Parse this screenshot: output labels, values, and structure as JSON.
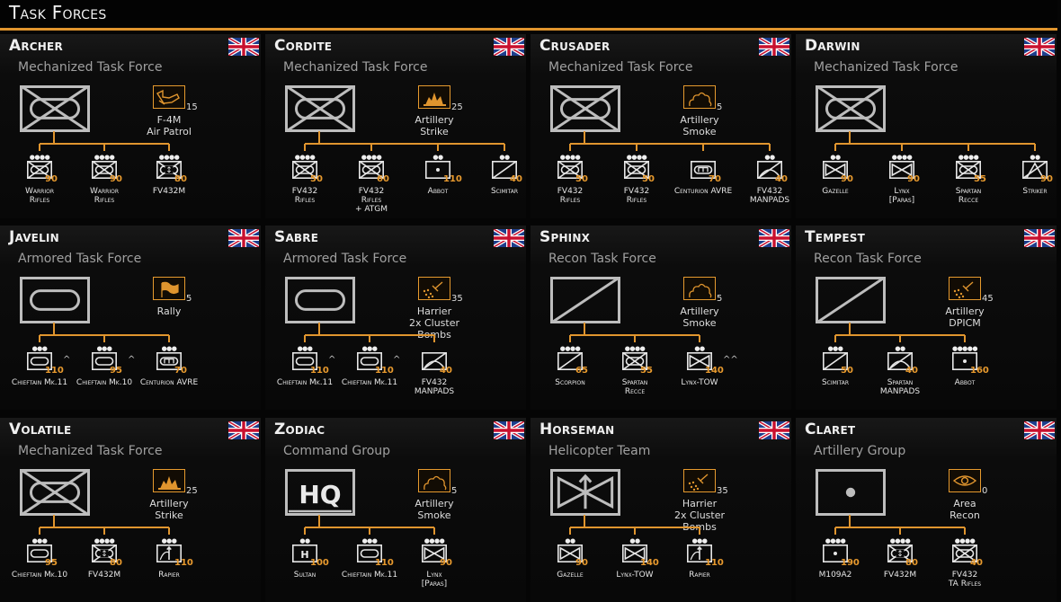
{
  "header": {
    "title": "Task Forces"
  },
  "colors": {
    "accent": "#e0952e",
    "value": "#e89a2e"
  },
  "cards": [
    {
      "name": "Archer",
      "type": "Mechanized Task Force",
      "symbol": "mech",
      "ability": {
        "icon": "jet-icon",
        "count": "15",
        "lines": [
          "F-4M",
          "Air Patrol"
        ]
      },
      "units": [
        {
          "dots": "●●●●",
          "sym": "mech",
          "val": "90",
          "lines": [
            "Warrior",
            "Rifles"
          ]
        },
        {
          "dots": "●●●●",
          "sym": "mech",
          "val": "90",
          "lines": [
            "Warrior",
            "Rifles"
          ]
        },
        {
          "dots": "●●●●",
          "sym": "apc",
          "val": "80",
          "lines": [
            "FV432M"
          ]
        }
      ]
    },
    {
      "name": "Cordite",
      "type": "Mechanized Task Force",
      "symbol": "mech",
      "ability": {
        "icon": "explosion-icon",
        "count": "25",
        "lines": [
          "Artillery",
          "Strike"
        ]
      },
      "units": [
        {
          "dots": "●●●●",
          "sym": "mech",
          "val": "50",
          "lines": [
            "FV432",
            "Rifles"
          ]
        },
        {
          "dots": "●●●●",
          "sym": "mech",
          "val": "60",
          "lines": [
            "FV432",
            "Rifles",
            "+ ATGM"
          ]
        },
        {
          "dots": "●●",
          "sym": "artillery",
          "val": "110",
          "lines": [
            "Abbot"
          ]
        },
        {
          "dots": "●●",
          "sym": "recon",
          "val": "40",
          "lines": [
            "Scimitar"
          ]
        }
      ]
    },
    {
      "name": "Crusader",
      "type": "Mechanized Task Force",
      "symbol": "mech",
      "ability": {
        "icon": "smoke-icon",
        "count": "5",
        "lines": [
          "Artillery",
          "Smoke"
        ]
      },
      "units": [
        {
          "dots": "●●●●",
          "sym": "mech",
          "val": "50",
          "lines": [
            "FV432",
            "Rifles"
          ]
        },
        {
          "dots": "●●●●",
          "sym": "mech",
          "val": "50",
          "lines": [
            "FV432",
            "Rifles"
          ]
        },
        {
          "dots": "",
          "sym": "engineer",
          "val": "70",
          "lines": [
            "Centurion AVRE"
          ]
        },
        {
          "dots": "●●",
          "sym": "airdefense",
          "val": "40",
          "lines": [
            "FV432",
            "MANPADS"
          ]
        }
      ]
    },
    {
      "name": "Darwin",
      "type": "Mechanized Task Force",
      "symbol": "mech",
      "ability": null,
      "units": [
        {
          "dots": "●●",
          "sym": "bowtie",
          "val": "90",
          "lines": [
            "Gazelle"
          ]
        },
        {
          "dots": "●●●●",
          "sym": "bowtie",
          "val": "90",
          "lines": [
            "Lynx",
            "[Paras]"
          ]
        },
        {
          "dots": "●●●●",
          "sym": "mech",
          "val": "55",
          "lines": [
            "Spartan",
            "Recce"
          ]
        },
        {
          "dots": "●●",
          "sym": "striker",
          "val": "90",
          "lines": [
            "Striker"
          ]
        }
      ]
    },
    {
      "name": "Javelin",
      "type": "Armored Task Force",
      "symbol": "armor",
      "ability": {
        "icon": "flag-icon",
        "count": "5",
        "lines": [
          "Rally"
        ]
      },
      "units": [
        {
          "dots": "●●●",
          "sym": "armor",
          "val": "110",
          "lines": [
            "Chieftain Mk.11"
          ],
          "marker": "^"
        },
        {
          "dots": "●●●",
          "sym": "armor",
          "val": "95",
          "lines": [
            "Chieftain Mk.10"
          ],
          "marker": "^"
        },
        {
          "dots": "●●●",
          "sym": "engineer",
          "val": "70",
          "lines": [
            "Centurion AVRE"
          ]
        }
      ]
    },
    {
      "name": "Sabre",
      "type": "Armored Task Force",
      "symbol": "armor",
      "ability": {
        "icon": "cluster-icon",
        "count": "35",
        "lines": [
          "Harrier",
          "2x Cluster",
          "Bombs"
        ]
      },
      "units": [
        {
          "dots": "●●●",
          "sym": "armor",
          "val": "110",
          "lines": [
            "Chieftain Mk.11"
          ],
          "marker": "^"
        },
        {
          "dots": "●●●",
          "sym": "armor",
          "val": "110",
          "lines": [
            "Chieftain Mk.11"
          ],
          "marker": "^"
        },
        {
          "dots": "",
          "sym": "airdefense",
          "val": "40",
          "lines": [
            "FV432",
            "MANPADS"
          ]
        }
      ]
    },
    {
      "name": "Sphinx",
      "type": "Recon Task Force",
      "symbol": "recon",
      "ability": {
        "icon": "smoke-icon",
        "count": "5",
        "lines": [
          "Artillery",
          "Smoke"
        ]
      },
      "units": [
        {
          "dots": "●●●●",
          "sym": "recon",
          "val": "65",
          "lines": [
            "Scorpion"
          ]
        },
        {
          "dots": "●●●●",
          "sym": "mech",
          "val": "55",
          "lines": [
            "Spartan",
            "Recce"
          ]
        },
        {
          "dots": "●●",
          "sym": "bowtie",
          "val": "140",
          "lines": [
            "Lynx-TOW"
          ],
          "marker": "^^"
        }
      ]
    },
    {
      "name": "Tempest",
      "type": "Recon Task Force",
      "symbol": "recon",
      "ability": {
        "icon": "cluster-icon",
        "count": "45",
        "lines": [
          "Artillery",
          "DPICM"
        ]
      },
      "units": [
        {
          "dots": "●●●",
          "sym": "recon",
          "val": "50",
          "lines": [
            "Scimitar"
          ]
        },
        {
          "dots": "●●",
          "sym": "airdefense",
          "val": "40",
          "lines": [
            "Spartan",
            "MANPADS"
          ]
        },
        {
          "dots": "●●●●●",
          "sym": "artillery",
          "val": "160",
          "lines": [
            "Abbot"
          ]
        }
      ]
    },
    {
      "name": "Volatile",
      "type": "Mechanized Task Force",
      "symbol": "mech",
      "ability": {
        "icon": "explosion-icon",
        "count": "25",
        "lines": [
          "Artillery",
          "Strike"
        ]
      },
      "units": [
        {
          "dots": "●●●",
          "sym": "armor",
          "val": "95",
          "lines": [
            "Chieftain Mk.10"
          ]
        },
        {
          "dots": "●●●●",
          "sym": "apc",
          "val": "80",
          "lines": [
            "FV432M"
          ]
        },
        {
          "dots": "●●●",
          "sym": "rapier",
          "val": "110",
          "lines": [
            "Rapier"
          ]
        }
      ]
    },
    {
      "name": "Zodiac",
      "type": "Command Group",
      "symbol": "hq",
      "ability": {
        "icon": "smoke-icon",
        "count": "5",
        "lines": [
          "Artillery",
          "Smoke"
        ]
      },
      "units": [
        {
          "dots": "●●",
          "sym": "hq",
          "val": "100",
          "lines": [
            "Sultan"
          ]
        },
        {
          "dots": "●●●",
          "sym": "armor",
          "val": "110",
          "lines": [
            "Chieftain Mk.11"
          ]
        },
        {
          "dots": "●●●●",
          "sym": "bowtie",
          "val": "90",
          "lines": [
            "Lynx",
            "[Paras]"
          ]
        }
      ]
    },
    {
      "name": "Horseman",
      "type": "Helicopter Team",
      "symbol": "heli",
      "ability": {
        "icon": "cluster-icon",
        "count": "35",
        "lines": [
          "Harrier",
          "2x Cluster",
          "Bombs"
        ]
      },
      "units": [
        {
          "dots": "●●",
          "sym": "bowtie",
          "val": "90",
          "lines": [
            "Gazelle"
          ]
        },
        {
          "dots": "●●",
          "sym": "bowtie",
          "val": "140",
          "lines": [
            "Lynx-TOW"
          ]
        },
        {
          "dots": "●●●",
          "sym": "rapier",
          "val": "110",
          "lines": [
            "Rapier"
          ]
        }
      ]
    },
    {
      "name": "Claret",
      "type": "Artillery Group",
      "symbol": "artillery",
      "ability": {
        "icon": "eye-icon",
        "count": "0",
        "lines": [
          "Area",
          "Recon"
        ]
      },
      "units": [
        {
          "dots": "●●●●",
          "sym": "artillery",
          "val": "190",
          "lines": [
            "M109A2"
          ]
        },
        {
          "dots": "●●●●",
          "sym": "apc",
          "val": "80",
          "lines": [
            "FV432M"
          ]
        },
        {
          "dots": "●●●●",
          "sym": "mech",
          "val": "40",
          "lines": [
            "FV432",
            "TA Rifles"
          ]
        }
      ]
    }
  ]
}
